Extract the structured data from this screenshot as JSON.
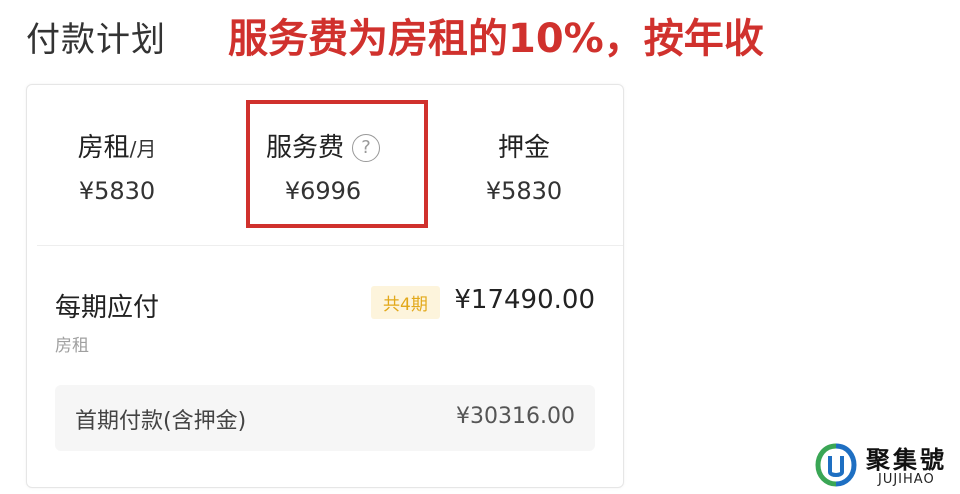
{
  "header": {
    "title": "付款计划",
    "annotation": "服务费为房租的10%，按年收"
  },
  "fees": {
    "rent": {
      "label": "房租",
      "unit": "/月",
      "value": "¥5830"
    },
    "service": {
      "label": "服务费",
      "help_icon": "?",
      "value": "¥6996"
    },
    "deposit": {
      "label": "押金",
      "value": "¥5830"
    }
  },
  "period": {
    "label": "每期应付",
    "sublabel": "房租",
    "badge": "共4期",
    "amount": "¥17490.00"
  },
  "first_payment": {
    "label": "首期付款(含押金)",
    "amount": "¥30316.00"
  },
  "watermark": {
    "name_cn": "聚集號",
    "name_en": "JUJIHAO",
    "colors": {
      "green": "#3aa655",
      "blue": "#1e6fc2"
    }
  },
  "colors": {
    "annotation_red": "#d0312d",
    "badge_bg": "#fdf4dc",
    "badge_text": "#e2a81a"
  }
}
